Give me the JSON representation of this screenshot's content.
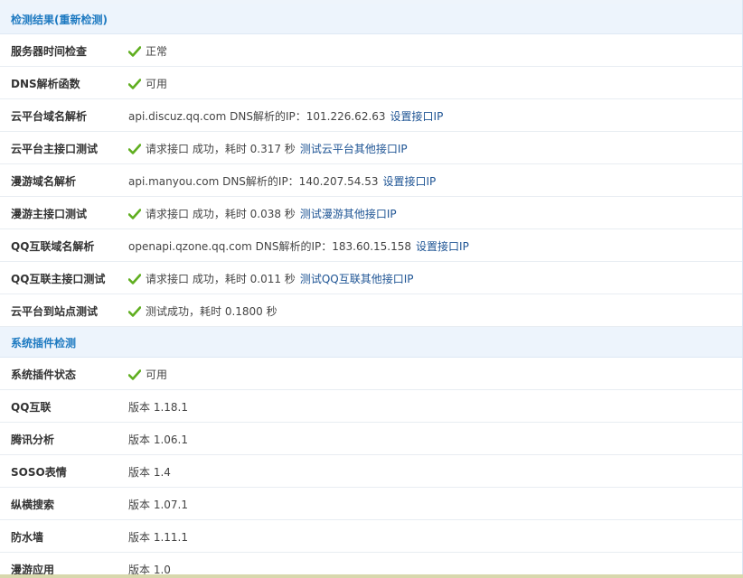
{
  "sections": [
    {
      "title": "检测结果(重新检测)",
      "rows": [
        {
          "label": "服务器时间检查",
          "check": true,
          "text": "正常"
        },
        {
          "label": "DNS解析函数",
          "check": true,
          "text": "可用"
        },
        {
          "label": "云平台域名解析",
          "check": false,
          "text": "api.discuz.qq.com DNS解析的IP：101.226.62.63",
          "link": "设置接口IP"
        },
        {
          "label": "云平台主接口测试",
          "check": true,
          "text": "请求接口 成功，耗时 0.317 秒",
          "link": "测试云平台其他接口IP"
        },
        {
          "label": "漫游域名解析",
          "check": false,
          "text": "api.manyou.com DNS解析的IP：140.207.54.53",
          "link": "设置接口IP"
        },
        {
          "label": "漫游主接口测试",
          "check": true,
          "text": "请求接口 成功，耗时 0.038 秒",
          "link": "测试漫游其他接口IP"
        },
        {
          "label": "QQ互联域名解析",
          "check": false,
          "text": "openapi.qzone.qq.com DNS解析的IP：183.60.15.158",
          "link": "设置接口IP"
        },
        {
          "label": "QQ互联主接口测试",
          "check": true,
          "text": "请求接口 成功，耗时 0.011 秒",
          "link": "测试QQ互联其他接口IP"
        },
        {
          "label": "云平台到站点测试",
          "check": true,
          "text": "测试成功，耗时 0.1800 秒"
        }
      ]
    },
    {
      "title": "系统插件检测",
      "rows": [
        {
          "label": "系统插件状态",
          "check": true,
          "text": "可用"
        },
        {
          "label": "QQ互联",
          "check": false,
          "text": "版本 1.18.1"
        },
        {
          "label": "腾讯分析",
          "check": false,
          "text": "版本 1.06.1"
        },
        {
          "label": "SOSO表情",
          "check": false,
          "text": "版本 1.4"
        },
        {
          "label": "纵横搜索",
          "check": false,
          "text": "版本 1.07.1"
        },
        {
          "label": "防水墙",
          "check": false,
          "text": "版本 1.11.1"
        },
        {
          "label": "漫游应用",
          "check": false,
          "text": "版本 1.0"
        }
      ]
    }
  ],
  "colors": {
    "header_bg": "#edf4fc",
    "header_text": "#1e7ac1",
    "link": "#1e5494",
    "check": "#5fae1f"
  },
  "icons": {
    "check": "check-icon"
  }
}
